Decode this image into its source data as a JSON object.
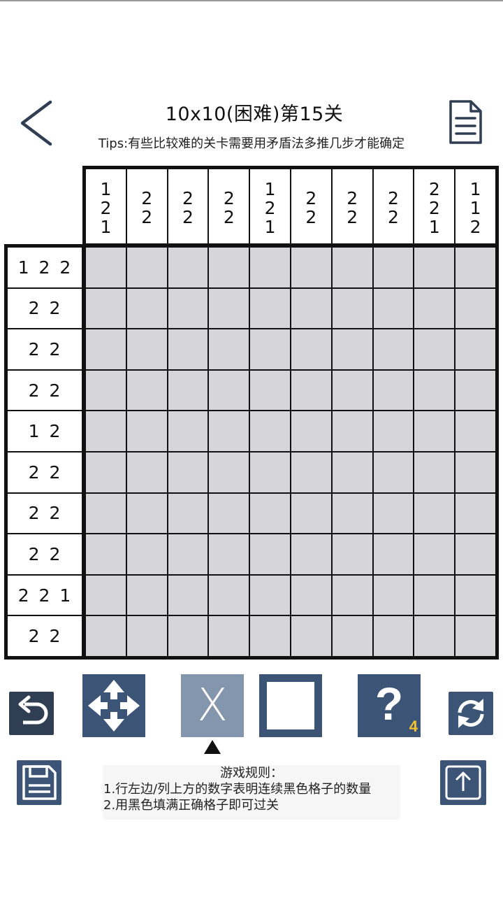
{
  "header": {
    "title": "10x10(困难)第15关",
    "tips": "Tips:有些比较难的关卡需要用矛盾法多推几步才能确定"
  },
  "puzzle": {
    "size": 10,
    "column_clues": [
      [
        "1",
        "2",
        "1"
      ],
      [
        "2",
        "2"
      ],
      [
        "2",
        "2"
      ],
      [
        "2",
        "2"
      ],
      [
        "1",
        "2",
        "1"
      ],
      [
        "2",
        "2"
      ],
      [
        "2",
        "2"
      ],
      [
        "2",
        "2"
      ],
      [
        "2",
        "2",
        "1"
      ],
      [
        "1",
        "1",
        "2"
      ]
    ],
    "row_clues": [
      "1 2 2",
      "2 2",
      "2 2",
      "2 2",
      "1 2",
      "2 2",
      "2 2",
      "2 2",
      "2 2 1",
      "2 2"
    ]
  },
  "toolbar": {
    "x_label": "X",
    "hint_label": "?",
    "hint_count": "4",
    "selected_tool": "x",
    "colors": {
      "primary": "#3c5475",
      "selected": "#8496ad",
      "dark": "#2f3e52",
      "hint_count": "#f1c232",
      "cell": "#d6d6d9"
    }
  },
  "rules": {
    "title": "游戏规则：",
    "items": [
      "1.行左边/列上方的数字表明连续黑色格子的数量",
      "2.用黑色填满正确格子即可过关"
    ]
  },
  "icons": {
    "back": "chevron-left-icon",
    "doc": "document-icon",
    "undo": "undo-icon",
    "move": "move-arrows-icon",
    "refresh": "refresh-icon",
    "save": "floppy-disk-icon",
    "share": "share-upload-icon"
  }
}
